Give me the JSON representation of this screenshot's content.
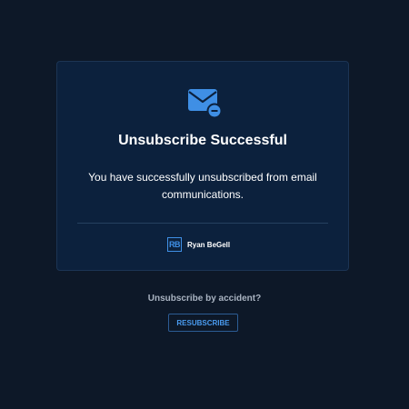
{
  "card": {
    "icon": "envelope-minus-icon",
    "title": "Unsubscribe Successful",
    "message": "You have successfully unsubscribed from email communications.",
    "brand": {
      "logo_text": "RB",
      "name": "Ryan BeGell"
    }
  },
  "footer": {
    "question": "Unsubscribe by accident?",
    "resubscribe_label": "RESUBSCRIBE"
  },
  "colors": {
    "background": "#0d1828",
    "card": "#0c213d",
    "accent": "#3f8fe5"
  }
}
